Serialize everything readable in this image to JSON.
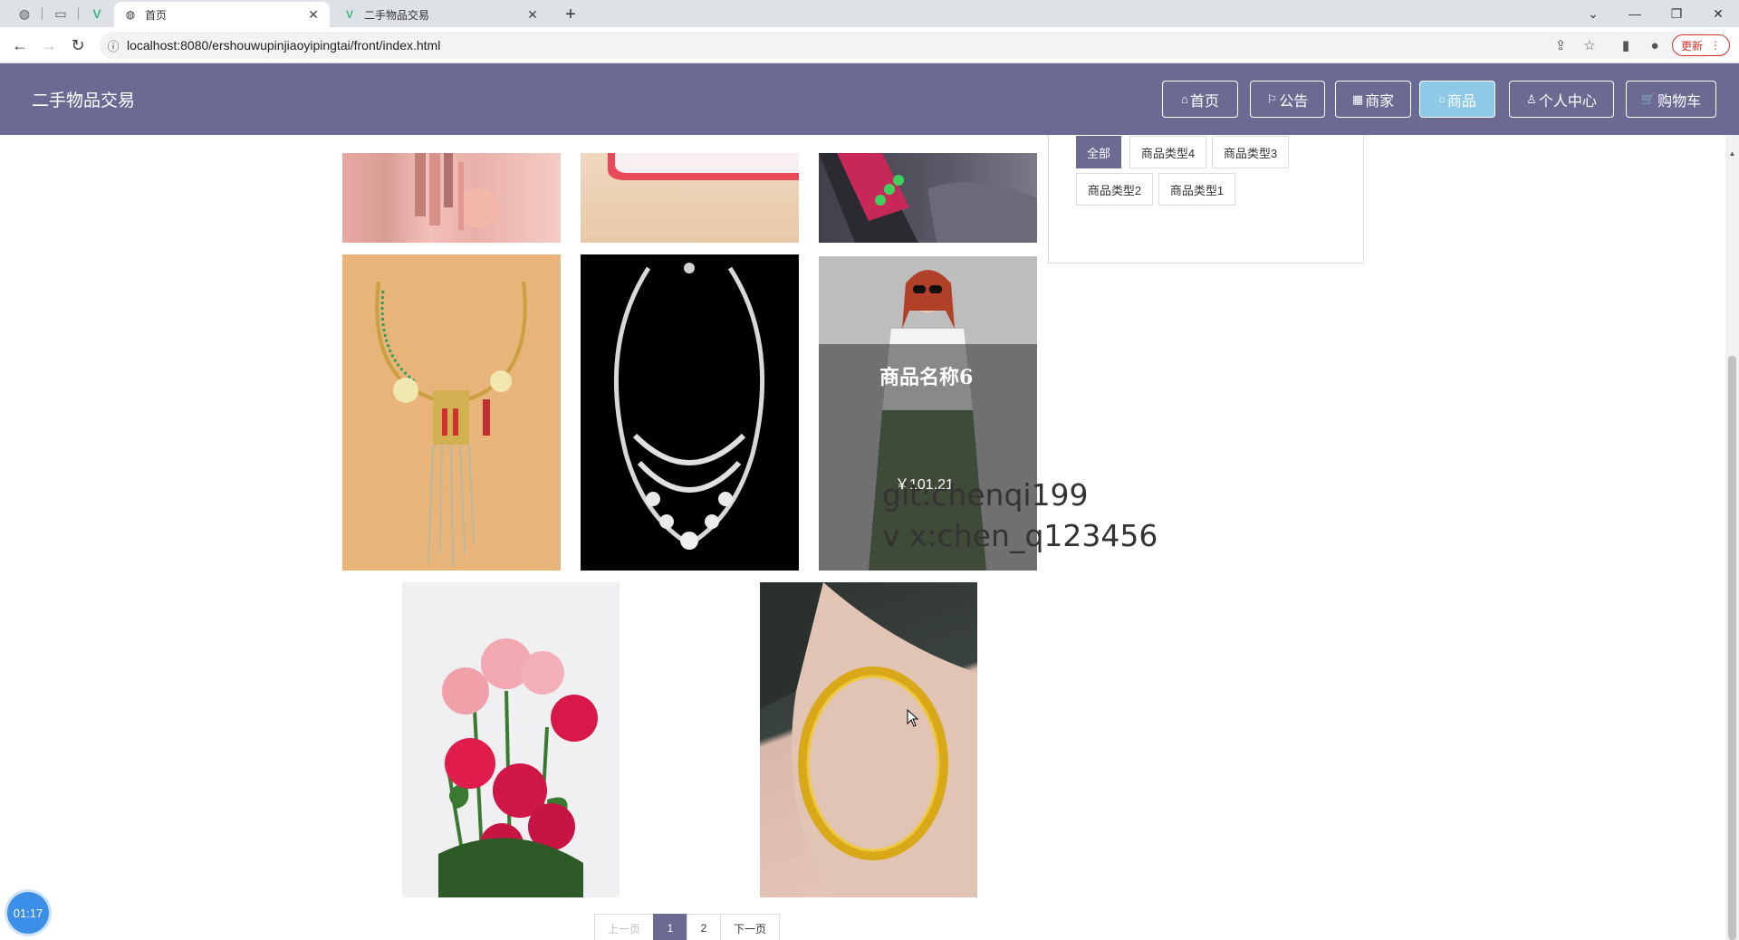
{
  "browser": {
    "tabs": [
      {
        "title": "首页",
        "active": true
      },
      {
        "title": "二手物品交易",
        "active": false
      }
    ],
    "url": "localhost:8080/ershouwupinjiaoyipingtai/front/index.html",
    "update_label": "更新"
  },
  "header": {
    "site_title": "二手物品交易",
    "nav": [
      {
        "label": "首页",
        "icon": "⌂"
      },
      {
        "label": "公告",
        "icon": "⚐"
      },
      {
        "label": "商家",
        "icon": "▦"
      },
      {
        "label": "商品",
        "icon": "○"
      },
      {
        "label": "个人中心",
        "icon": "♙"
      },
      {
        "label": "购物车",
        "icon": "🛒"
      }
    ],
    "active_nav": "商品"
  },
  "categories": {
    "items": [
      "全部",
      "商品类型4",
      "商品类型3",
      "商品类型2",
      "商品类型1"
    ],
    "active": "全部"
  },
  "hovered_product": {
    "name": "商品名称6",
    "price": "￥101.21"
  },
  "watermark": {
    "line1": "git:chenqi199",
    "line2": "v x:chen_q123456"
  },
  "pagination": {
    "prev": "上一页",
    "pages": [
      "1",
      "2"
    ],
    "current": "1",
    "next": "下一页"
  },
  "timer": "01:17"
}
